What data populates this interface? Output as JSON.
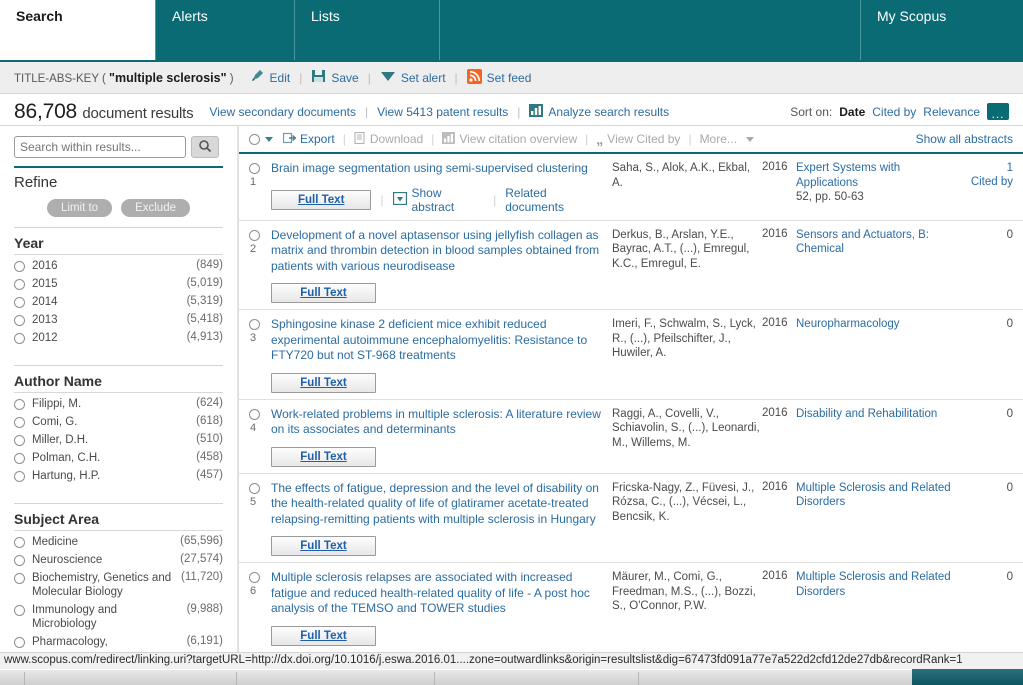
{
  "nav": {
    "tabs": [
      {
        "label": "Search",
        "active": true
      },
      {
        "label": "Alerts",
        "active": false
      },
      {
        "label": "Lists",
        "active": false
      },
      {
        "label": "My Scopus",
        "active": false
      }
    ]
  },
  "query_bar": {
    "field": "TITLE-ABS-KEY",
    "open_paren": "(",
    "term": "\"multiple sclerosis\"",
    "close_paren": ")",
    "actions": [
      {
        "label": "Edit",
        "icon": "pencil-icon"
      },
      {
        "label": "Save",
        "icon": "floppy-disk-icon"
      },
      {
        "label": "Set alert",
        "icon": "alert-bell-icon"
      },
      {
        "label": "Set feed",
        "icon": "rss-feed-icon"
      }
    ],
    "separator": "|"
  },
  "results_header": {
    "count": "86,708",
    "count_label": "document results",
    "links": [
      "View secondary documents",
      "View 5413 patent results",
      "Analyze search results"
    ],
    "analyze_icon": "bar-chart-icon",
    "separator": "|",
    "sort_label": "Sort on:",
    "sort_options": [
      {
        "label": "Date",
        "selected": true
      },
      {
        "label": "Cited by",
        "selected": false
      },
      {
        "label": "Relevance",
        "selected": false
      }
    ],
    "more_sort_label": "..."
  },
  "refine": {
    "search_within_placeholder": "Search within results...",
    "search_within_value": "",
    "search_icon": "magnifier-icon",
    "title": "Refine",
    "limit_to_label": "Limit to",
    "exclude_label": "Exclude",
    "facets": [
      {
        "name": "Year",
        "items": [
          {
            "label": "2016",
            "count": "(849)"
          },
          {
            "label": "2015",
            "count": "(5,019)"
          },
          {
            "label": "2014",
            "count": "(5,319)"
          },
          {
            "label": "2013",
            "count": "(5,418)"
          },
          {
            "label": "2012",
            "count": "(4,913)"
          }
        ]
      },
      {
        "name": "Author Name",
        "items": [
          {
            "label": "Filippi, M.",
            "count": "(624)"
          },
          {
            "label": "Comi, G.",
            "count": "(618)"
          },
          {
            "label": "Miller, D.H.",
            "count": "(510)"
          },
          {
            "label": "Polman, C.H.",
            "count": "(458)"
          },
          {
            "label": "Hartung, H.P.",
            "count": "(457)"
          }
        ]
      },
      {
        "name": "Subject Area",
        "items": [
          {
            "label": "Medicine",
            "count": "(65,596)"
          },
          {
            "label": "Neuroscience",
            "count": "(27,574)"
          },
          {
            "label": "Biochemistry, Genetics and Molecular Biology",
            "count": "(11,720)"
          },
          {
            "label": "Immunology and Microbiology",
            "count": "(9,988)"
          },
          {
            "label": "Pharmacology,",
            "count": "(6,191)"
          }
        ]
      }
    ]
  },
  "toolbar": {
    "export_label": "Export",
    "export_icon": "export-icon",
    "download_label": "Download",
    "download_icon": "download-icon",
    "citation_overview_label": "View citation overview",
    "citation_overview_icon": "bar-chart-icon",
    "view_cited_by_label": "View Cited by",
    "view_cited_by_icon": "quote-icon",
    "more_label": "More...",
    "separator": "|",
    "show_all_abstracts_label": "Show all abstracts"
  },
  "row_actions": {
    "full_text_label": "Full Text",
    "show_abstract_label": "Show abstract",
    "show_abstract_icon": "expand-abstract-icon",
    "related_documents_label": "Related documents",
    "separator": "|"
  },
  "results": [
    {
      "num": "1",
      "title": "Brain image segmentation using semi-supervised clustering",
      "authors": "Saha, S., Alok, A.K., Ekbal, A.",
      "year": "2016",
      "source": "Expert Systems with Applications",
      "volume": "52, pp. 50-63",
      "cited_count": "1",
      "cited_text": "Cited by",
      "has_show_abstract": true
    },
    {
      "num": "2",
      "title": "Development of a novel aptasensor using jellyfish collagen as matrix and thrombin detection in blood samples obtained from patients with various neurodisease",
      "authors": "Derkus, B., Arslan, Y.E., Bayrac, A.T., (...), Emregul, K.C., Emregul, E.",
      "year": "2016",
      "source": "Sensors and Actuators, B: Chemical",
      "volume": "",
      "cited_count": "0",
      "cited_text": "",
      "has_show_abstract": false
    },
    {
      "num": "3",
      "title": "Sphingosine kinase 2 deficient mice exhibit reduced experimental autoimmune encephalomyelitis: Resistance to FTY720 but not ST-968 treatments",
      "authors": "Imeri, F., Schwalm, S., Lyck, R., (...), Pfeilschifter, J., Huwiler, A.",
      "year": "2016",
      "source": "Neuropharmacology",
      "volume": "",
      "cited_count": "0",
      "cited_text": "",
      "has_show_abstract": false
    },
    {
      "num": "4",
      "title": "Work-related problems in multiple sclerosis: A literature review on its associates and determinants",
      "authors": "Raggi, A., Covelli, V., Schiavolin, S., (...), Leonardi, M., Willems, M.",
      "year": "2016",
      "source": "Disability and Rehabilitation",
      "volume": "",
      "cited_count": "0",
      "cited_text": "",
      "has_show_abstract": false
    },
    {
      "num": "5",
      "title": "The effects of fatigue, depression and the level of disability on the health-related quality of life of glatiramer acetate-treated relapsing-remitting patients with multiple sclerosis in Hungary",
      "authors": "Fricska-Nagy, Z., Füvesi, J., Rózsa, C., (...), Vécsei, L., Bencsik, K.",
      "year": "2016",
      "source": "Multiple Sclerosis and Related Disorders",
      "volume": "",
      "cited_count": "0",
      "cited_text": "",
      "has_show_abstract": false
    },
    {
      "num": "6",
      "title": "Multiple sclerosis relapses are associated with increased fatigue and reduced health-related quality of life - A post hoc analysis of the TEMSO and TOWER studies",
      "authors": "Mäurer, M., Comi, G., Freedman, M.S., (...), Bozzi, S., O'Connor, P.W.",
      "year": "2016",
      "source": "Multiple Sclerosis and Related Disorders",
      "volume": "",
      "cited_count": "0",
      "cited_text": "",
      "has_show_abstract": false
    }
  ],
  "status_bar": {
    "url": "www.scopus.com/redirect/linking.uri?targetURL=http://dx.doi.org/10.1016/j.eswa.2016.01....zone=outwardlinks&origin=resultslist&dig=67473fd091a77e7a522d2cfd12de27db&recordRank=1"
  },
  "colors": {
    "brand_teal": "#0b6b75",
    "link_blue": "#2b6ca3",
    "rss_orange": "#f26522",
    "muted_gray": "#a9a9a9"
  }
}
